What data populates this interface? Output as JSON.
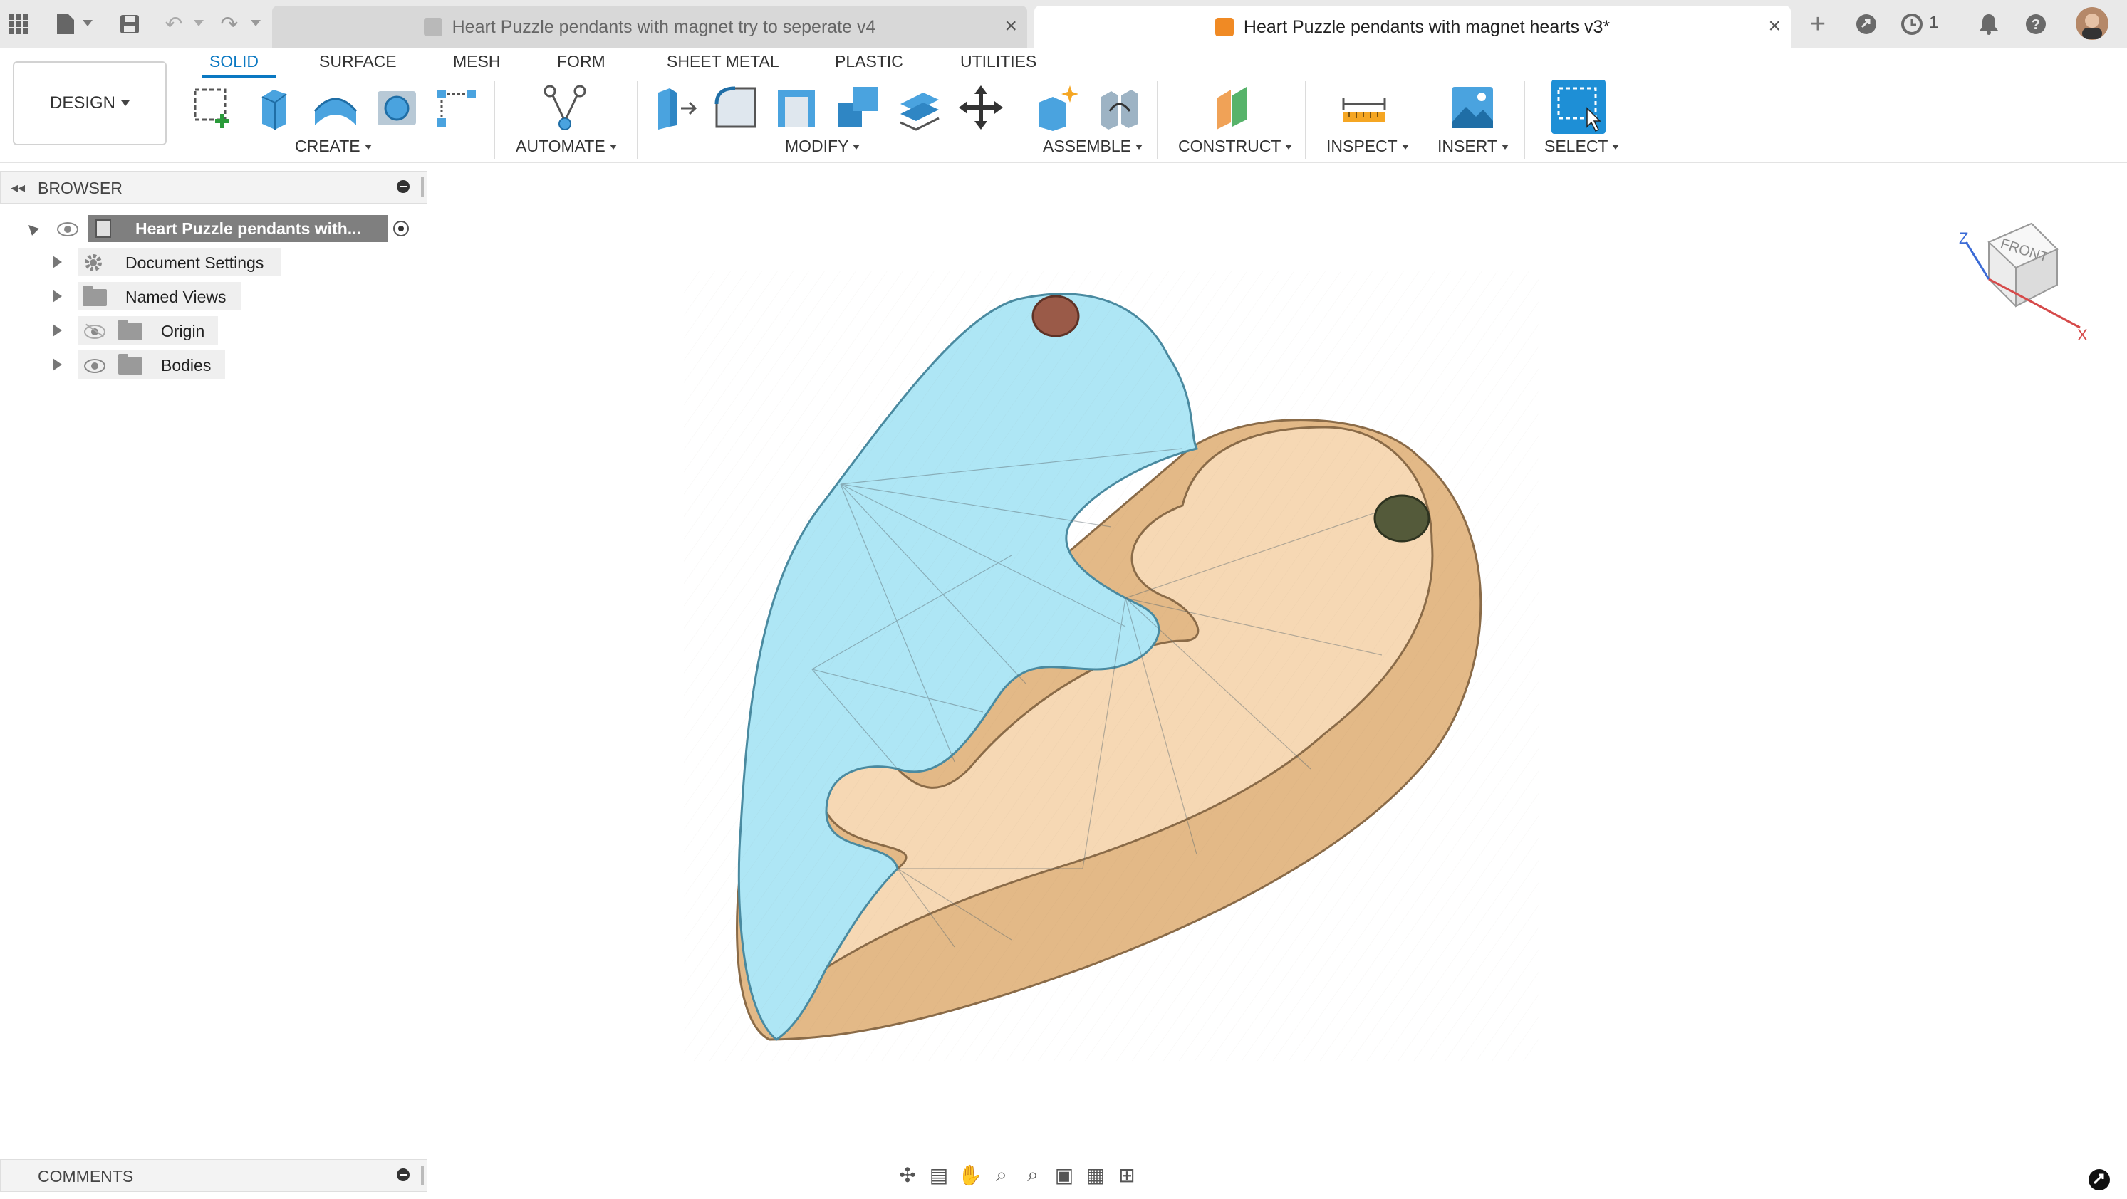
{
  "tabs": {
    "inactive": {
      "title": "Heart Puzzle pendants with magnet try to seperate v4"
    },
    "active": {
      "title": "Heart Puzzle pendants with magnet hearts v3*"
    },
    "jobs_count": "1"
  },
  "ribbon": {
    "workspace": "DESIGN",
    "tabs": [
      "SOLID",
      "SURFACE",
      "MESH",
      "FORM",
      "SHEET METAL",
      "PLASTIC",
      "UTILITIES"
    ],
    "groups": {
      "create": "CREATE",
      "automate": "AUTOMATE",
      "modify": "MODIFY",
      "assemble": "ASSEMBLE",
      "construct": "CONSTRUCT",
      "inspect": "INSPECT",
      "insert": "INSERT",
      "select": "SELECT"
    }
  },
  "browser": {
    "title": "BROWSER",
    "root": "Heart Puzzle pendants with...",
    "items": [
      "Document Settings",
      "Named Views",
      "Origin",
      "Bodies"
    ]
  },
  "comments": {
    "title": "COMMENTS"
  },
  "viewcube": {
    "face": "FRONT",
    "axis_z": "Z",
    "axis_x": "X"
  },
  "colors": {
    "accent": "#0a78c2",
    "part_blue": "#aee6f5",
    "part_tan": "#f6d8b4",
    "active_tab_icon": "#f08a24"
  }
}
